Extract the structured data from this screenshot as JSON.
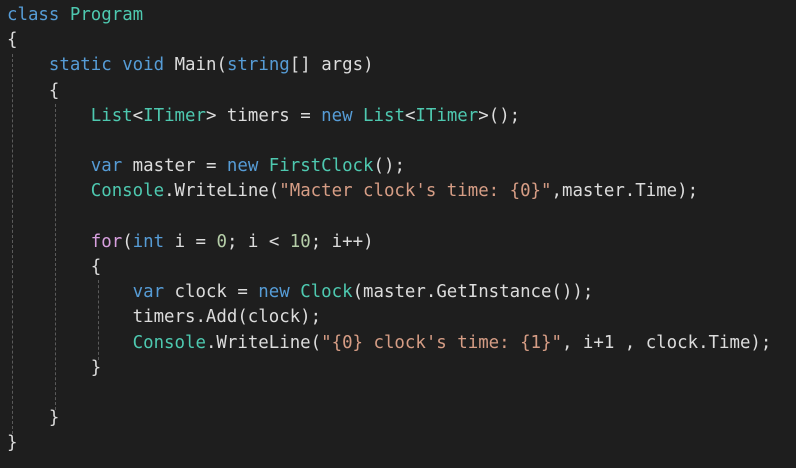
{
  "editor": {
    "background": "#1e1e1e",
    "colors": {
      "keyword": "#569cd6",
      "control_keyword": "#d8a0df",
      "type": "#4ec9b0",
      "identifier": "#dcdcdc",
      "string": "#d69d85",
      "number": "#b5cea8"
    },
    "lines": [
      {
        "tokens": [
          [
            "kw",
            "class"
          ],
          [
            "p",
            " "
          ],
          [
            "type",
            "Program"
          ]
        ]
      },
      {
        "tokens": [
          [
            "p",
            "{"
          ]
        ]
      },
      {
        "tokens": [
          [
            "p",
            "    "
          ],
          [
            "kw",
            "static"
          ],
          [
            "p",
            " "
          ],
          [
            "kw",
            "void"
          ],
          [
            "p",
            " "
          ],
          [
            "id",
            "Main"
          ],
          [
            "p",
            "("
          ],
          [
            "kw",
            "string"
          ],
          [
            "p",
            "[] args)"
          ]
        ]
      },
      {
        "tokens": [
          [
            "p",
            "    {"
          ]
        ]
      },
      {
        "tokens": [
          [
            "p",
            "        "
          ],
          [
            "type",
            "List"
          ],
          [
            "p",
            "<"
          ],
          [
            "type",
            "ITimer"
          ],
          [
            "p",
            "> timers = "
          ],
          [
            "kw",
            "new"
          ],
          [
            "p",
            " "
          ],
          [
            "type",
            "List"
          ],
          [
            "p",
            "<"
          ],
          [
            "type",
            "ITimer"
          ],
          [
            "p",
            ">();"
          ]
        ]
      },
      {
        "tokens": [
          [
            "p",
            ""
          ]
        ]
      },
      {
        "tokens": [
          [
            "p",
            "        "
          ],
          [
            "kw",
            "var"
          ],
          [
            "p",
            " master = "
          ],
          [
            "kw",
            "new"
          ],
          [
            "p",
            " "
          ],
          [
            "type",
            "FirstClock"
          ],
          [
            "p",
            "();"
          ]
        ]
      },
      {
        "tokens": [
          [
            "p",
            "        "
          ],
          [
            "type",
            "Console"
          ],
          [
            "p",
            "."
          ],
          [
            "id",
            "WriteLine"
          ],
          [
            "p",
            "("
          ],
          [
            "str",
            "\"Macter clock's time: {0}\""
          ],
          [
            "p",
            ",master.Time);"
          ]
        ]
      },
      {
        "tokens": [
          [
            "p",
            ""
          ]
        ]
      },
      {
        "tokens": [
          [
            "p",
            "        "
          ],
          [
            "kw2",
            "for"
          ],
          [
            "p",
            "("
          ],
          [
            "kw",
            "int"
          ],
          [
            "p",
            " i = "
          ],
          [
            "num",
            "0"
          ],
          [
            "p",
            "; i < "
          ],
          [
            "num",
            "10"
          ],
          [
            "p",
            "; i++)"
          ]
        ]
      },
      {
        "tokens": [
          [
            "p",
            "        {"
          ]
        ]
      },
      {
        "tokens": [
          [
            "p",
            "            "
          ],
          [
            "kw",
            "var"
          ],
          [
            "p",
            " clock = "
          ],
          [
            "kw",
            "new"
          ],
          [
            "p",
            " "
          ],
          [
            "type",
            "Clock"
          ],
          [
            "p",
            "(master.GetInstance());"
          ]
        ]
      },
      {
        "tokens": [
          [
            "p",
            "            timers.Add(clock);"
          ]
        ]
      },
      {
        "tokens": [
          [
            "p",
            "            "
          ],
          [
            "type",
            "Console"
          ],
          [
            "p",
            "."
          ],
          [
            "id",
            "WriteLine"
          ],
          [
            "p",
            "("
          ],
          [
            "str",
            "\"{0} clock's time: {1}\""
          ],
          [
            "p",
            ", i+1 , clock.Time);"
          ]
        ]
      },
      {
        "tokens": [
          [
            "p",
            "        }"
          ]
        ]
      },
      {
        "tokens": [
          [
            "p",
            ""
          ]
        ]
      },
      {
        "tokens": [
          [
            "p",
            "    }"
          ]
        ]
      },
      {
        "tokens": [
          [
            "p",
            "}"
          ]
        ]
      }
    ]
  }
}
